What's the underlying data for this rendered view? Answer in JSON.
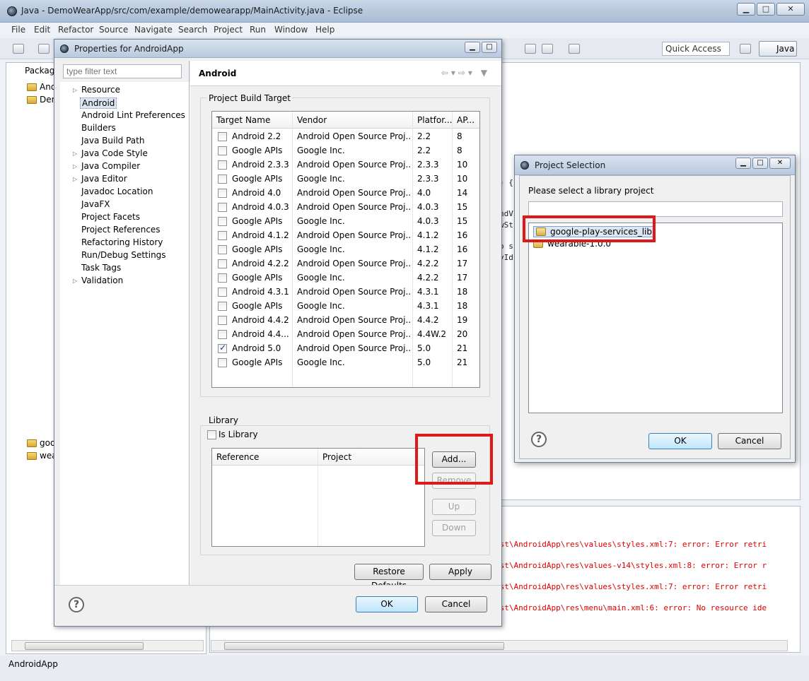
{
  "window": {
    "title": "Java - DemoWearApp/src/com/example/demowearapp/MainActivity.java - Eclipse",
    "menu": [
      "File",
      "Edit",
      "Refactor",
      "Source",
      "Navigate",
      "Search",
      "Project",
      "Run",
      "Window",
      "Help"
    ],
    "quick_access": "Quick Access",
    "perspective": "Java",
    "status": "AndroidApp"
  },
  "package_explorer": {
    "tab": "Packag",
    "items": [
      "And",
      "Dem",
      "goo",
      "wea"
    ]
  },
  "editor": {
    "fragments": [
      ") {",
      "ndV",
      "wSt",
      "o s",
      "yId"
    ]
  },
  "console": {
    "lines": [
      "est\\AndroidApp\\res\\values\\styles.xml:7: error: Error retri",
      "est\\AndroidApp\\res\\values-v14\\styles.xml:8: error: Error r",
      "est\\AndroidApp\\res\\values\\styles.xml:7: error: Error retri",
      "est\\AndroidApp\\res\\menu\\main.xml:6: error: No resource ide"
    ]
  },
  "properties": {
    "title": "Properties for AndroidApp",
    "filter_placeholder": "type filter text",
    "nav": [
      {
        "label": "Resource",
        "arrow": true
      },
      {
        "label": "Android",
        "arrow": false,
        "selected": true
      },
      {
        "label": "Android Lint Preferences",
        "arrow": false
      },
      {
        "label": "Builders",
        "arrow": false
      },
      {
        "label": "Java Build Path",
        "arrow": false
      },
      {
        "label": "Java Code Style",
        "arrow": true
      },
      {
        "label": "Java Compiler",
        "arrow": true
      },
      {
        "label": "Java Editor",
        "arrow": true
      },
      {
        "label": "Javadoc Location",
        "arrow": false
      },
      {
        "label": "JavaFX",
        "arrow": false
      },
      {
        "label": "Project Facets",
        "arrow": false
      },
      {
        "label": "Project References",
        "arrow": false
      },
      {
        "label": "Refactoring History",
        "arrow": false
      },
      {
        "label": "Run/Debug Settings",
        "arrow": false
      },
      {
        "label": "Task Tags",
        "arrow": false
      },
      {
        "label": "Validation",
        "arrow": true
      }
    ],
    "page_title": "Android",
    "build_target": {
      "label": "Project Build Target",
      "columns": [
        "Target Name",
        "Vendor",
        "Platfor...",
        "AP..."
      ],
      "rows": [
        {
          "name": "Android 2.2",
          "vendor": "Android Open Source Proj...",
          "platform": "2.2",
          "api": "8",
          "checked": false
        },
        {
          "name": "Google APIs",
          "vendor": "Google Inc.",
          "platform": "2.2",
          "api": "8",
          "checked": false
        },
        {
          "name": "Android 2.3.3",
          "vendor": "Android Open Source Proj...",
          "platform": "2.3.3",
          "api": "10",
          "checked": false
        },
        {
          "name": "Google APIs",
          "vendor": "Google Inc.",
          "platform": "2.3.3",
          "api": "10",
          "checked": false
        },
        {
          "name": "Android 4.0",
          "vendor": "Android Open Source Proj...",
          "platform": "4.0",
          "api": "14",
          "checked": false
        },
        {
          "name": "Android 4.0.3",
          "vendor": "Android Open Source Proj...",
          "platform": "4.0.3",
          "api": "15",
          "checked": false
        },
        {
          "name": "Google APIs",
          "vendor": "Google Inc.",
          "platform": "4.0.3",
          "api": "15",
          "checked": false
        },
        {
          "name": "Android 4.1.2",
          "vendor": "Android Open Source Proj...",
          "platform": "4.1.2",
          "api": "16",
          "checked": false
        },
        {
          "name": "Google APIs",
          "vendor": "Google Inc.",
          "platform": "4.1.2",
          "api": "16",
          "checked": false
        },
        {
          "name": "Android 4.2.2",
          "vendor": "Android Open Source Proj...",
          "platform": "4.2.2",
          "api": "17",
          "checked": false
        },
        {
          "name": "Google APIs",
          "vendor": "Google Inc.",
          "platform": "4.2.2",
          "api": "17",
          "checked": false
        },
        {
          "name": "Android 4.3.1",
          "vendor": "Android Open Source Proj...",
          "platform": "4.3.1",
          "api": "18",
          "checked": false
        },
        {
          "name": "Google APIs",
          "vendor": "Google Inc.",
          "platform": "4.3.1",
          "api": "18",
          "checked": false
        },
        {
          "name": "Android 4.4.2",
          "vendor": "Android Open Source Proj...",
          "platform": "4.4.2",
          "api": "19",
          "checked": false
        },
        {
          "name": "Android 4.4...",
          "vendor": "Android Open Source Proj...",
          "platform": "4.4W.2",
          "api": "20",
          "checked": false
        },
        {
          "name": "Android 5.0",
          "vendor": "Android Open Source Proj...",
          "platform": "5.0",
          "api": "21",
          "checked": true
        },
        {
          "name": "Google APIs",
          "vendor": "Google Inc.",
          "platform": "5.0",
          "api": "21",
          "checked": false
        }
      ]
    },
    "library": {
      "label": "Library",
      "is_library": "Is Library",
      "columns": [
        "Reference",
        "Project"
      ],
      "buttons": {
        "add": "Add...",
        "remove": "Remove",
        "up": "Up",
        "down": "Down"
      }
    },
    "restore_defaults": "Restore Defaults",
    "apply": "Apply",
    "ok": "OK",
    "cancel": "Cancel"
  },
  "project_selection": {
    "title": "Project Selection",
    "prompt": "Please select a library project",
    "items": [
      "google-play-services_lib",
      "wearable-1.0.0"
    ],
    "ok": "OK",
    "cancel": "Cancel"
  },
  "highlight_color": "#e01818"
}
